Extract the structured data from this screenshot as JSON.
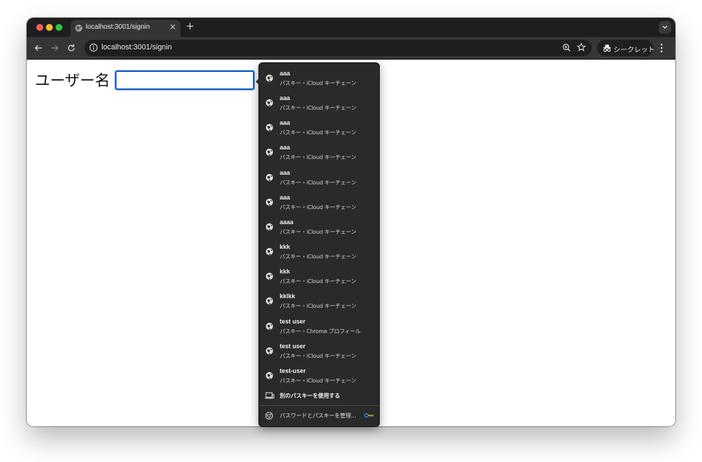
{
  "tab": {
    "title": "localhost:3001/signin",
    "close_glyph": "×",
    "new_tab_glyph": "+"
  },
  "toolbar": {
    "url": "localhost:3001/signin",
    "incognito_label": "シークレット"
  },
  "form": {
    "username_label": "ユーザー名",
    "username_value": ""
  },
  "passkey_popup": {
    "items": [
      {
        "name": "aaa",
        "source": "パスキー・iCloud キーチェーン"
      },
      {
        "name": "aaa",
        "source": "パスキー・iCloud キーチェーン"
      },
      {
        "name": "aaa",
        "source": "パスキー・iCloud キーチェーン"
      },
      {
        "name": "aaa",
        "source": "パスキー・iCloud キーチェーン"
      },
      {
        "name": "aaa",
        "source": "パスキー・iCloud キーチェーン"
      },
      {
        "name": "aaa",
        "source": "パスキー・iCloud キーチェーン"
      },
      {
        "name": "aaaa",
        "source": "パスキー・iCloud キーチェーン"
      },
      {
        "name": "kkk",
        "source": "パスキー・iCloud キーチェーン"
      },
      {
        "name": "kkk",
        "source": "パスキー・iCloud キーチェーン"
      },
      {
        "name": "kklkk",
        "source": "パスキー・iCloud キーチェーン"
      },
      {
        "name": "test user",
        "source": "パスキー・Chrome プロフィール"
      },
      {
        "name": "test user",
        "source": "パスキー・iCloud キーチェーン"
      },
      {
        "name": "test-user",
        "source": "パスキー・iCloud キーチェーン"
      }
    ],
    "use_other_label": "別のパスキーを使用する",
    "manage_label": "パスワードとパスキーを管理..."
  },
  "icons": {
    "globe": "globe-icon",
    "devices": "devices-icon",
    "chrome": "chrome-icon",
    "key": "key-icon"
  },
  "colors": {
    "tabbar_bg": "#1e1e1f",
    "toolbar_bg": "#353537",
    "popup_bg": "#2a2a2b",
    "input_focus": "#1a5fc7"
  }
}
